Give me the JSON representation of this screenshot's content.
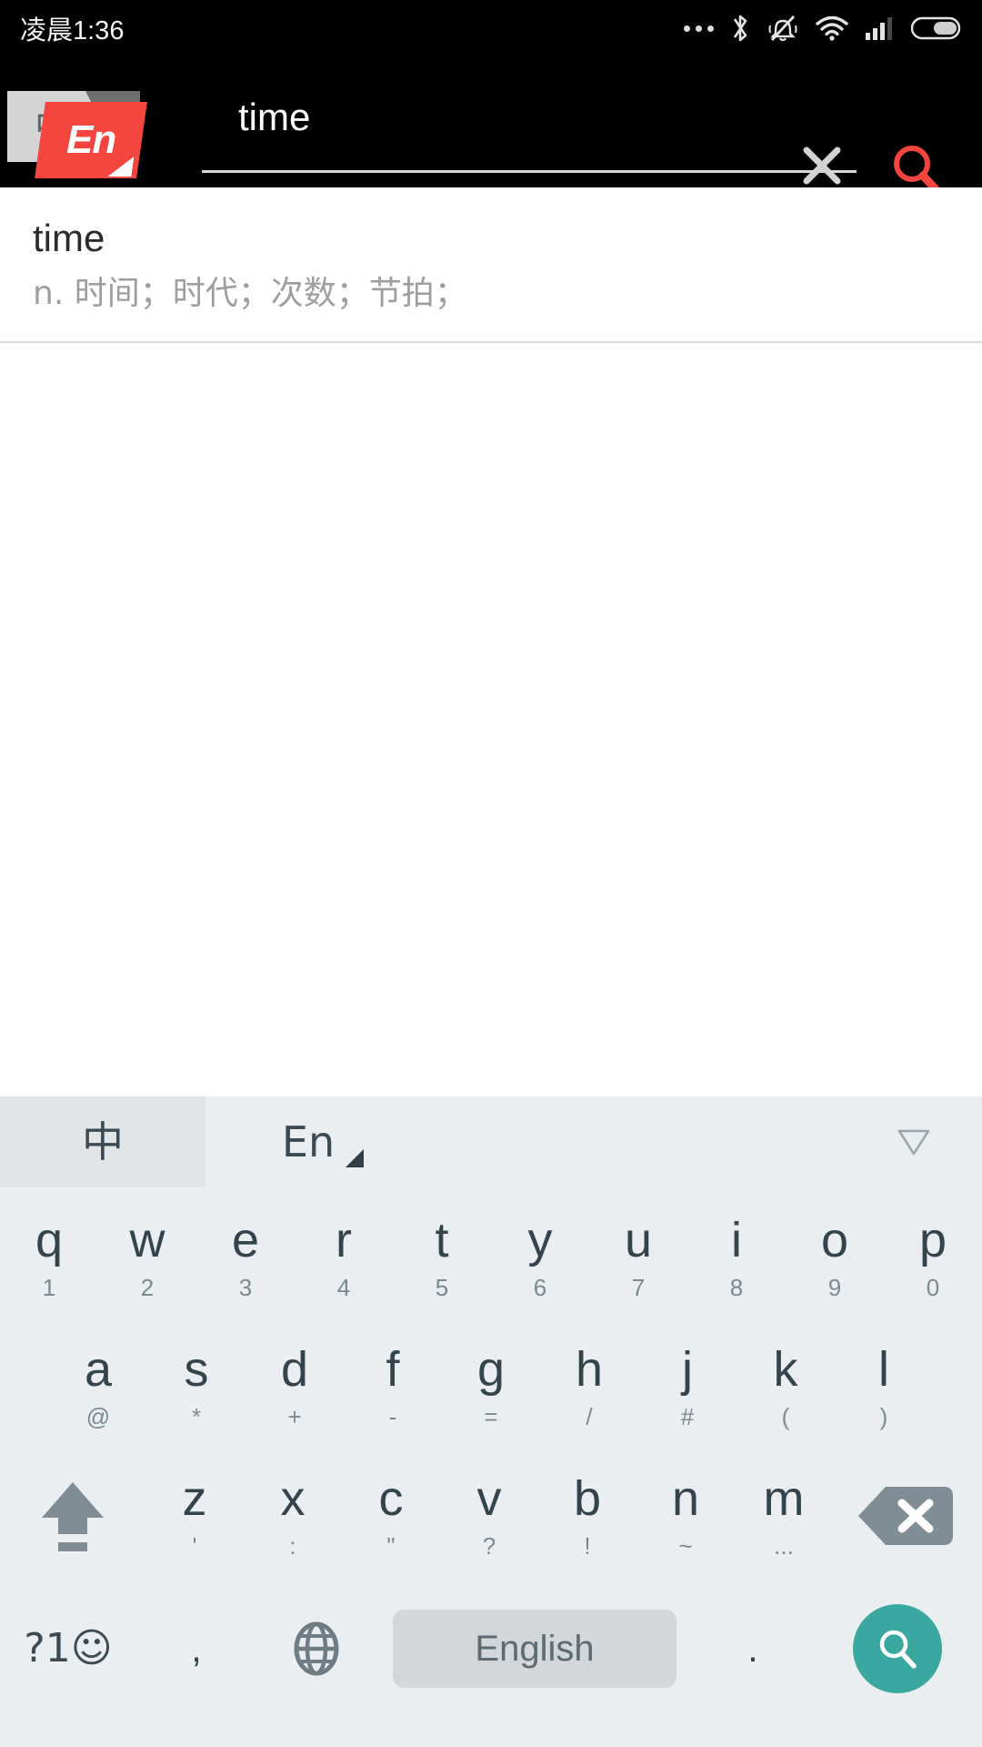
{
  "status_bar": {
    "time": "凌晨1:36",
    "icons": [
      "more-dots-icon",
      "bluetooth-icon",
      "silent-bell-icon",
      "wifi-icon",
      "signal-icon",
      "battery-icon"
    ]
  },
  "app": {
    "logo_back_text": "中",
    "logo_front_text": "En",
    "accent_red": "#f4463f"
  },
  "search": {
    "value": "time",
    "placeholder": "",
    "clear_icon": "close-icon",
    "search_icon": "search-icon"
  },
  "results": [
    {
      "word": "time",
      "definition": "n. 时间；时代；次数；节拍；"
    }
  ],
  "keyboard": {
    "toolbar": {
      "tab_cn": "中",
      "tab_en": "En",
      "collapse_icon": "chevron-down-icon"
    },
    "row1": [
      {
        "main": "q",
        "sub": "1"
      },
      {
        "main": "w",
        "sub": "2"
      },
      {
        "main": "e",
        "sub": "3"
      },
      {
        "main": "r",
        "sub": "4"
      },
      {
        "main": "t",
        "sub": "5"
      },
      {
        "main": "y",
        "sub": "6"
      },
      {
        "main": "u",
        "sub": "7"
      },
      {
        "main": "i",
        "sub": "8"
      },
      {
        "main": "o",
        "sub": "9"
      },
      {
        "main": "p",
        "sub": "0"
      }
    ],
    "row2": [
      {
        "main": "a",
        "sub": "@"
      },
      {
        "main": "s",
        "sub": "*"
      },
      {
        "main": "d",
        "sub": "+"
      },
      {
        "main": "f",
        "sub": "-"
      },
      {
        "main": "g",
        "sub": "="
      },
      {
        "main": "h",
        "sub": "/"
      },
      {
        "main": "j",
        "sub": "#"
      },
      {
        "main": "k",
        "sub": "("
      },
      {
        "main": "l",
        "sub": ")"
      }
    ],
    "row3": [
      {
        "main": "z",
        "sub": "'"
      },
      {
        "main": "x",
        "sub": ":"
      },
      {
        "main": "c",
        "sub": "\""
      },
      {
        "main": "v",
        "sub": "?"
      },
      {
        "main": "b",
        "sub": "!"
      },
      {
        "main": "n",
        "sub": "~"
      },
      {
        "main": "m",
        "sub": "..."
      }
    ],
    "shift_icon": "shift-arrow-icon",
    "backspace_icon": "backspace-icon",
    "row4": {
      "symbols_label": "?1☺",
      "comma": ",",
      "globe_icon": "globe-icon",
      "space_label": "English",
      "period": ".",
      "enter_icon": "search-icon"
    },
    "colors": {
      "background": "#eaeef1",
      "key_text": "#33444d",
      "enter_button": "#3aa8a0",
      "space_key": "#d3d7da"
    }
  }
}
